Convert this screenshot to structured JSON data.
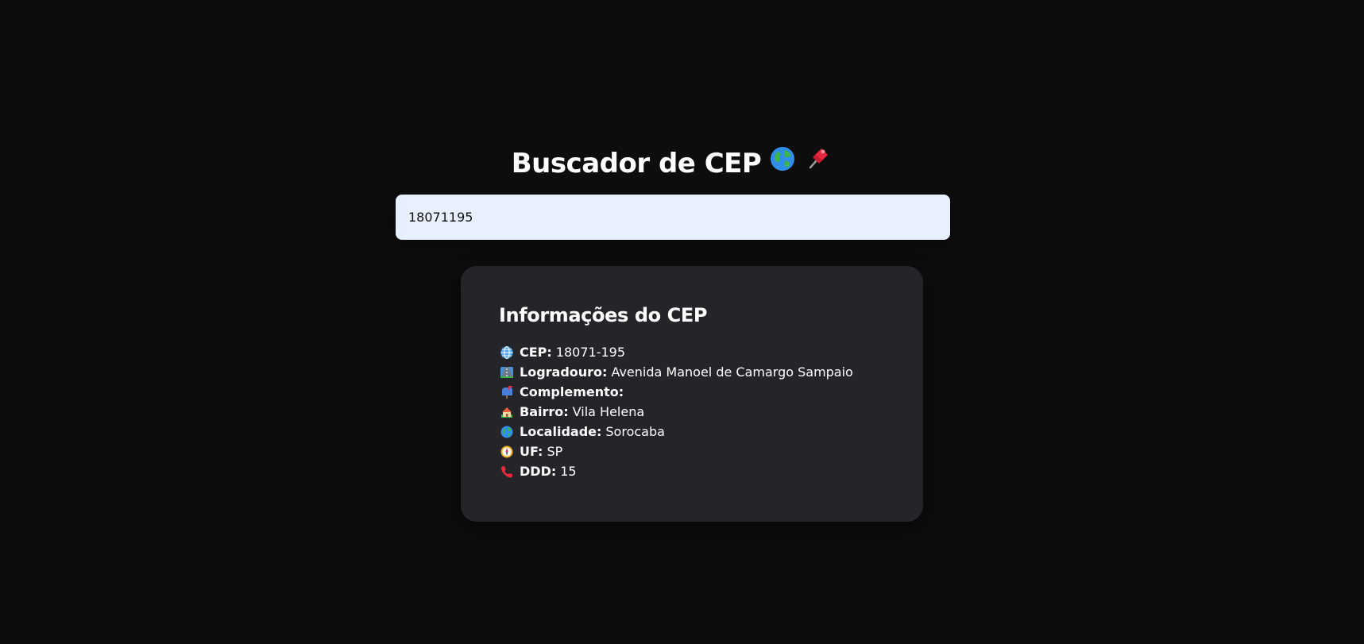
{
  "header": {
    "title": "Buscador de CEP",
    "icons": [
      "globe-icon",
      "pushpin-icon"
    ]
  },
  "search": {
    "value": "18071195"
  },
  "card": {
    "title": "Informações do CEP",
    "items": [
      {
        "icon": "globe-meridians-icon",
        "label": "CEP:",
        "value": "18071-195"
      },
      {
        "icon": "motorway-icon",
        "label": "Logradouro:",
        "value": "Avenida Manoel de Camargo Sampaio"
      },
      {
        "icon": "mailbox-icon",
        "label": "Complemento:",
        "value": ""
      },
      {
        "icon": "house-icon",
        "label": "Bairro:",
        "value": "Vila Helena"
      },
      {
        "icon": "globe-icon",
        "label": "Localidade:",
        "value": "Sorocaba"
      },
      {
        "icon": "compass-icon",
        "label": "UF:",
        "value": "SP"
      },
      {
        "icon": "telephone-receiver-icon",
        "label": "DDD:",
        "value": "15"
      }
    ]
  },
  "colors": {
    "background": "#0d0d0e",
    "card": "#252429",
    "input": "#e8f0fe",
    "text": "#ffffff"
  }
}
